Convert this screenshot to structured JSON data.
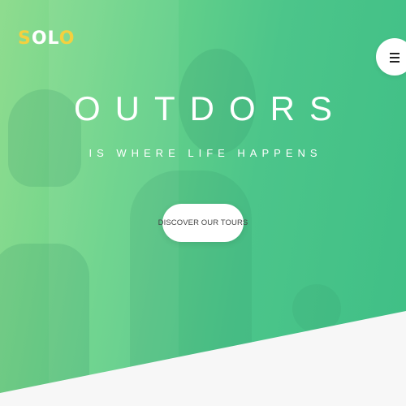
{
  "brand": {
    "logo_part1": "S",
    "logo_part2": "OL",
    "logo_part3": "O"
  },
  "hero": {
    "title": "OUTDORS",
    "subtitle": "IS WHERE LIFE HAPPENS",
    "cta_label": "DISCOVER OUR TOURS"
  },
  "icons": {
    "menu": "hamburger-menu-icon"
  },
  "colors": {
    "gradient_start": "#8fdc8f",
    "gradient_end": "#3fbf86",
    "logo_accent": "#f4d03f",
    "page_background": "#f7f7f7"
  }
}
